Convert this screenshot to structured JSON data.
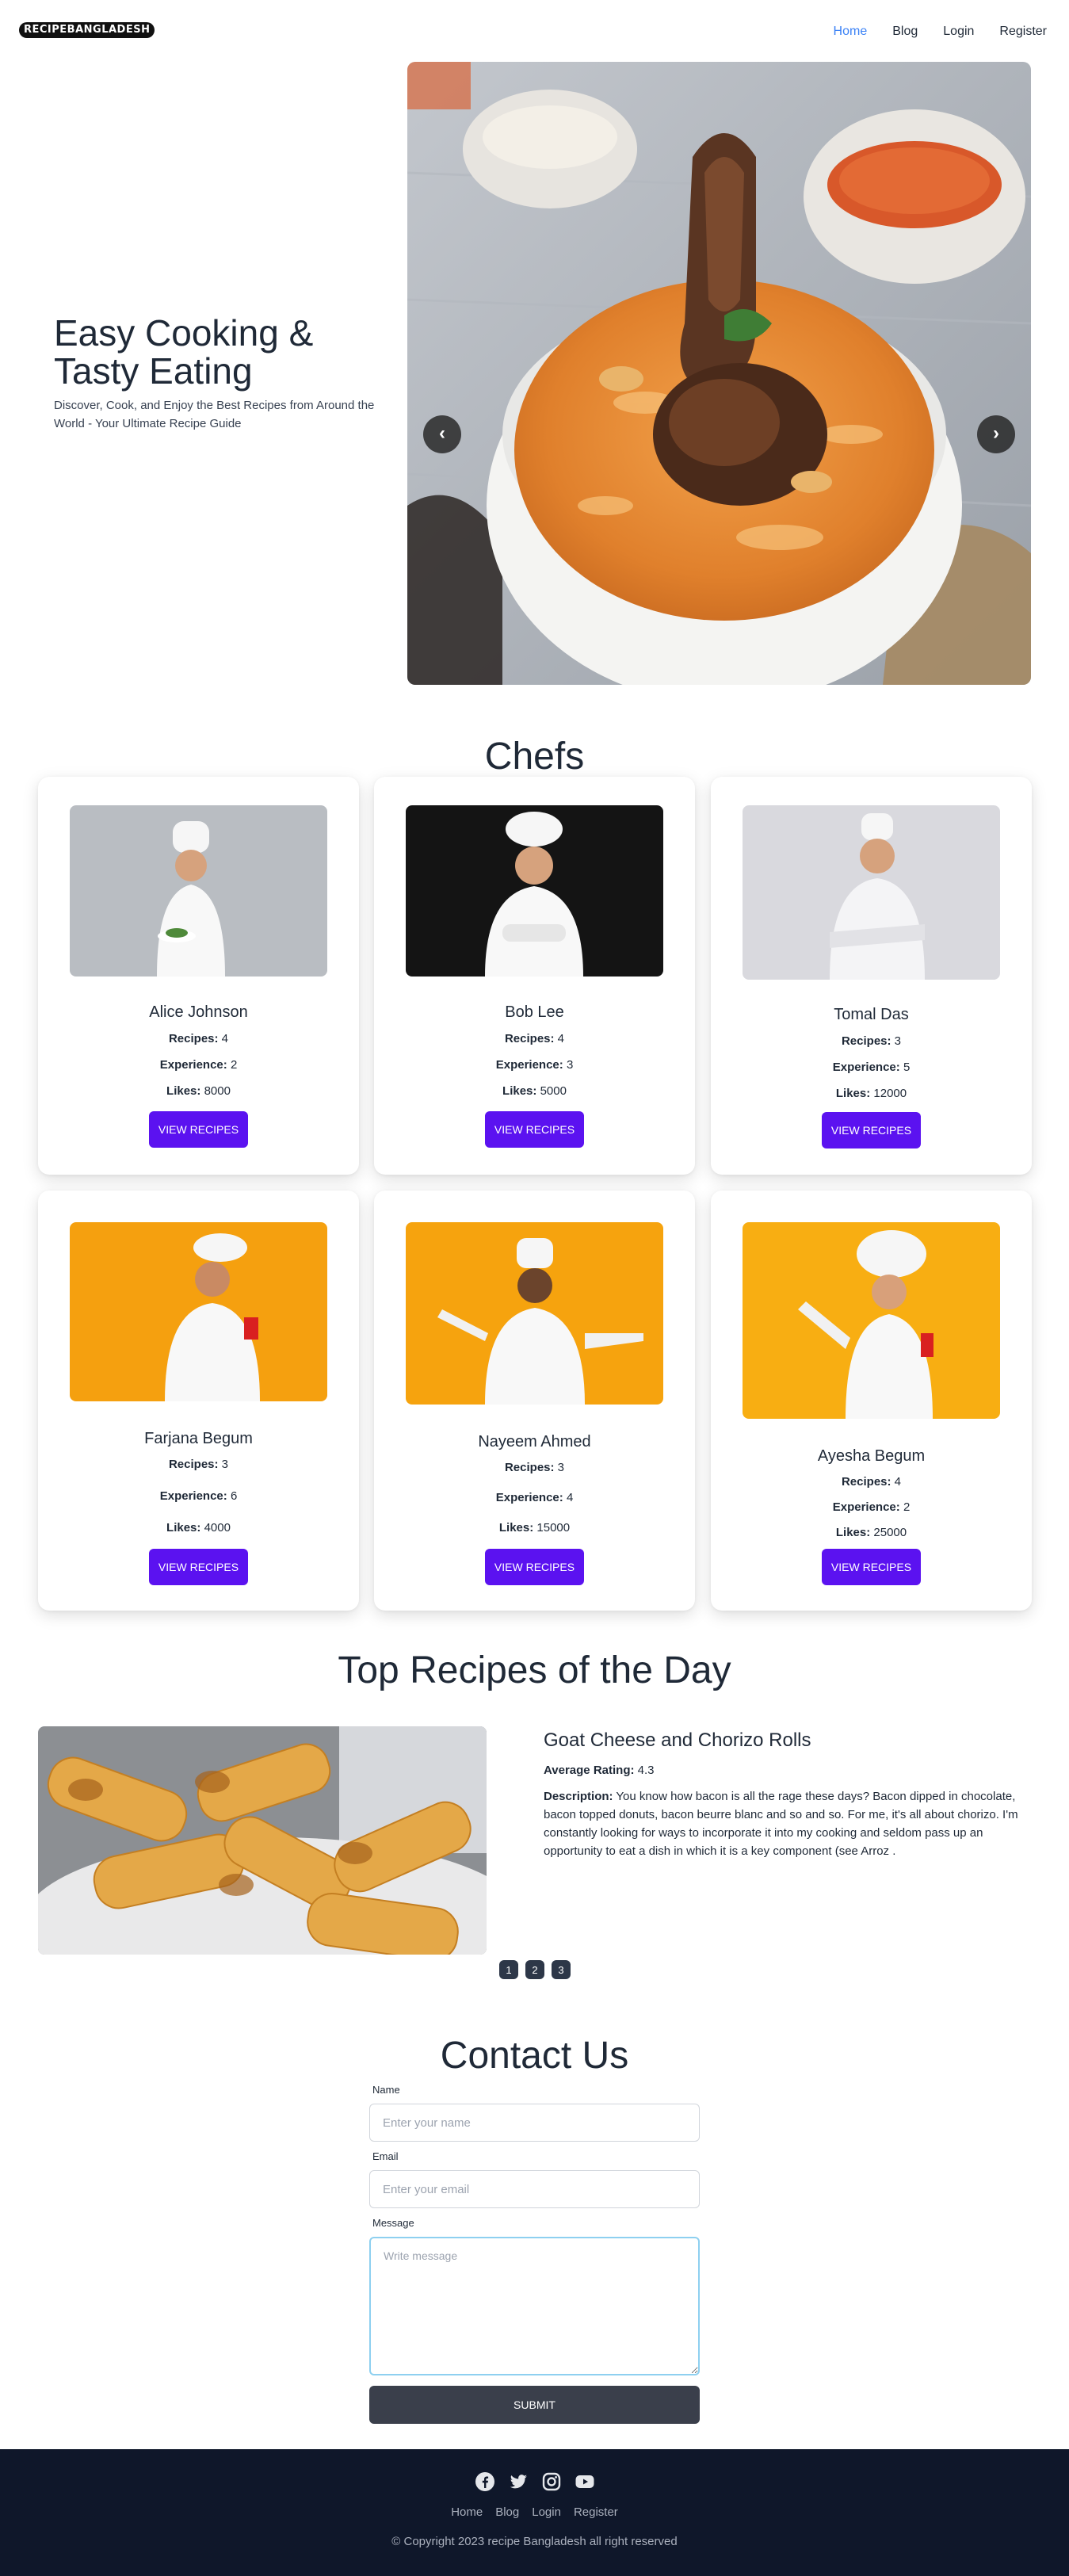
{
  "nav": {
    "logo": "RECIPEBANGLADESH",
    "links": [
      "Home",
      "Blog",
      "Login",
      "Register"
    ]
  },
  "hero": {
    "title": "Easy Cooking & Tasty Eating",
    "subtitle": "Discover, Cook, and Enjoy the Best Recipes from Around the World - Your Ultimate Recipe Guide",
    "prev_glyph": "‹",
    "next_glyph": "›"
  },
  "chefs": {
    "title": "Chefs",
    "stat_labels": {
      "recipes": "Recipes:",
      "experience": "Experience:",
      "likes": "Likes:"
    },
    "button_label": "View Recipes",
    "items": [
      {
        "name": "Alice Johnson",
        "recipes": "4",
        "experience": "2",
        "likes": "8000"
      },
      {
        "name": "Bob Lee",
        "recipes": "4",
        "experience": "3",
        "likes": "5000"
      },
      {
        "name": "Tomal Das",
        "recipes": "3",
        "experience": "5",
        "likes": "12000"
      },
      {
        "name": "Farjana Begum",
        "recipes": "3",
        "experience": "6",
        "likes": "4000"
      },
      {
        "name": "Nayeem Ahmed",
        "recipes": "3",
        "experience": "4",
        "likes": "15000"
      },
      {
        "name": "Ayesha Begum",
        "recipes": "4",
        "experience": "2",
        "likes": "25000"
      }
    ]
  },
  "top_recipes": {
    "title": "Top Recipes of the Day",
    "recipe_name": "Goat Cheese and Chorizo Rolls",
    "rating_label": "Average Rating:",
    "rating": "4.3",
    "description_label": "Description:",
    "description": "You know how bacon is all the rage these days? Bacon dipped in chocolate, bacon topped donuts, bacon beurre blanc and so and so. For me, it's all about chorizo. I'm constantly looking for ways to incorporate it into my cooking and seldom pass up an opportunity to eat a dish in which it is a key component (see Arroz .",
    "pages": [
      "1",
      "2",
      "3"
    ]
  },
  "contact": {
    "title": "Contact Us",
    "name_label": "Name",
    "name_placeholder": "Enter your name",
    "email_label": "Email",
    "email_placeholder": "Enter your email",
    "message_label": "Message",
    "message_placeholder": "Write message",
    "submit_label": "Submit"
  },
  "footer": {
    "socials": [
      "facebook-icon",
      "twitter-icon",
      "instagram-icon",
      "youtube-icon"
    ],
    "links": [
      "Home",
      "Blog",
      "Login",
      "Register"
    ],
    "copyright": "© Copyright 2023 recipe Bangladesh all right reserved"
  },
  "colors": {
    "accent": "#5b12f0",
    "nav_active": "#3b82f6",
    "footer_bg": "#0f172a",
    "submit_bg": "#3a3f4b"
  }
}
